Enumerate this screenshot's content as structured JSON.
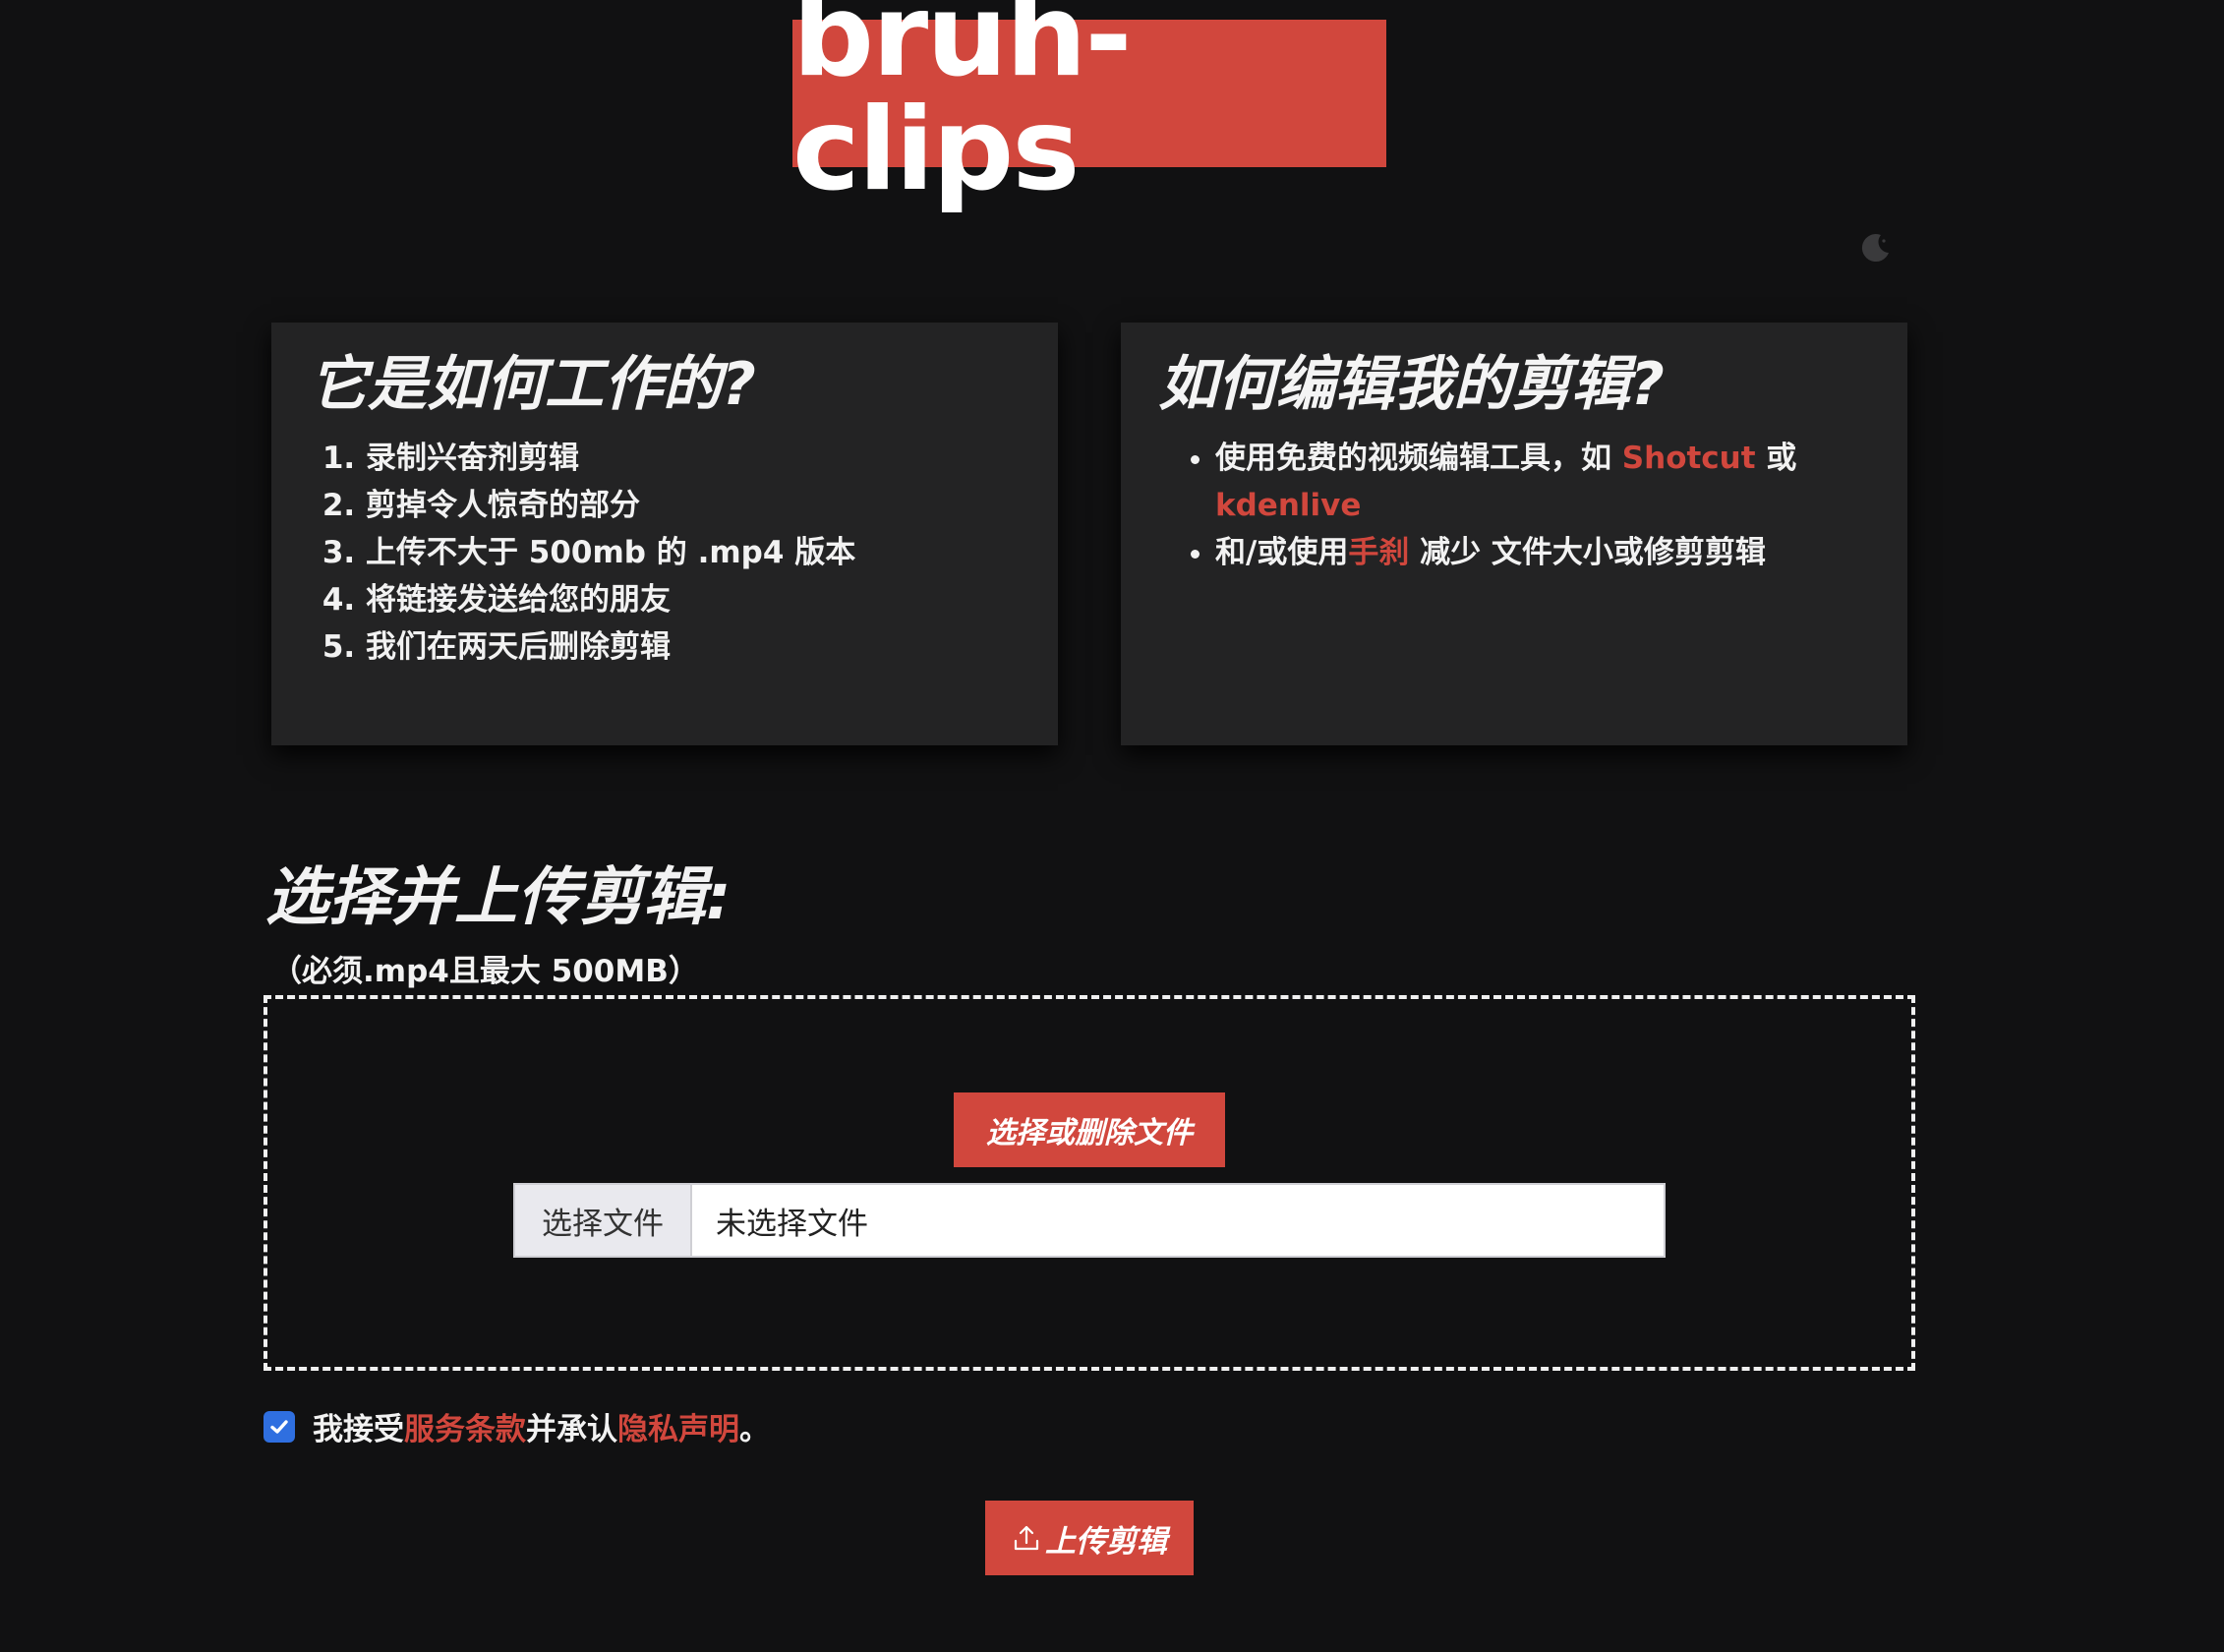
{
  "header": {
    "logo_text": "bruh-clips"
  },
  "icons": {
    "theme_toggle": "moon-icon",
    "checkbox": "checkmark-icon",
    "upload": "upload-icon"
  },
  "colors": {
    "accent": "#d1473d",
    "background": "#111112",
    "card": "#232324",
    "checkbox": "#2f6fe0"
  },
  "how_it_works": {
    "title": "它是如何工作的?",
    "steps": [
      "录制兴奋剂剪辑",
      "剪掉令人惊奇的部分",
      "上传不大于 500mb 的 .mp4 版本",
      "将链接发送给您的朋友",
      "我们在两天后删除剪辑"
    ]
  },
  "how_to_edit": {
    "title": "如何编辑我的剪辑?",
    "item1": {
      "prefix": "使用免费的视频编辑工具，如 ",
      "link1": "Shotcut",
      "middle": " 或",
      "link2": "kdenlive"
    },
    "item2": {
      "prefix": "和/或使用",
      "link": "手刹",
      "suffix": " 减少 文件大小或修剪剪辑"
    }
  },
  "upload": {
    "title": "选择并上传剪辑:",
    "subtitle": "（必须.mp4且最大 500MB）",
    "pick_button": "选择或删除文件",
    "file_button": "选择文件",
    "file_status": "未选择文件",
    "submit_button": "上传剪辑"
  },
  "terms": {
    "checked": true,
    "prefix": "我接受",
    "tos_link": "服务条款",
    "middle": "并承认 ",
    "privacy_link": "隐私声明",
    "suffix": "。"
  }
}
